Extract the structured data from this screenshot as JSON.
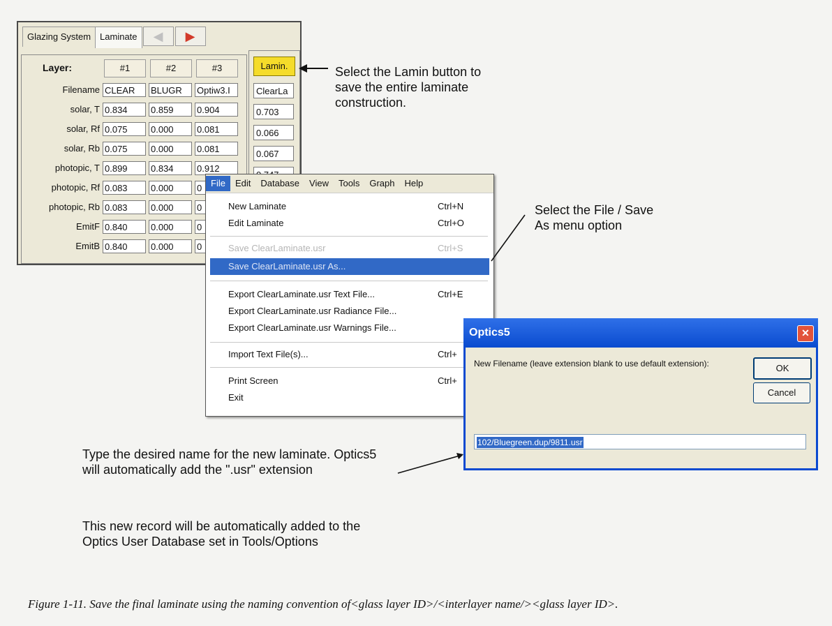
{
  "tabs": {
    "glazing_system": "Glazing System",
    "laminate": "Laminate",
    "prev_arrow": "◀",
    "next_arrow": "▶"
  },
  "grid": {
    "layer_header": "Layer:",
    "columns": [
      "#1",
      "#2",
      "#3"
    ],
    "row_labels": [
      "Filename",
      "solar, T",
      "solar, Rf",
      "solar, Rb",
      "photopic, T",
      "photopic, Rf",
      "photopic, Rb",
      "EmitF",
      "EmitB"
    ],
    "rows": [
      [
        "CLEAR",
        "BLUGR",
        "Optiw3.I"
      ],
      [
        "0.834",
        "0.859",
        "0.904"
      ],
      [
        "0.075",
        "0.000",
        "0.081"
      ],
      [
        "0.075",
        "0.000",
        "0.081"
      ],
      [
        "0.899",
        "0.834",
        "0.912"
      ],
      [
        "0.083",
        "0.000",
        "0"
      ],
      [
        "0.083",
        "0.000",
        "0"
      ],
      [
        "0.840",
        "0.000",
        "0"
      ],
      [
        "0.840",
        "0.000",
        "0"
      ]
    ],
    "lamin_button": "Lamin.",
    "lamin_values": [
      "ClearLa",
      "0.703",
      "0.066",
      "0.067",
      "0.747"
    ]
  },
  "menu": {
    "bar": [
      "File",
      "Edit",
      "Database",
      "View",
      "Tools",
      "Graph",
      "Help"
    ],
    "items": [
      {
        "label": "New Laminate",
        "shortcut": "Ctrl+N"
      },
      {
        "label": "Edit Laminate",
        "shortcut": "Ctrl+O"
      },
      {
        "label": "Save ClearLaminate.usr",
        "shortcut": "Ctrl+S"
      },
      {
        "label": "Save ClearLaminate.usr As...",
        "shortcut": ""
      },
      {
        "label": "Export ClearLaminate.usr Text File...",
        "shortcut": "Ctrl+E"
      },
      {
        "label": "Export ClearLaminate.usr Radiance File...",
        "shortcut": ""
      },
      {
        "label": "Export ClearLaminate.usr Warnings File...",
        "shortcut": ""
      },
      {
        "label": "Import Text File(s)...",
        "shortcut": "Ctrl+"
      },
      {
        "label": "Print Screen",
        "shortcut": "Ctrl+"
      },
      {
        "label": "Exit",
        "shortcut": ""
      }
    ]
  },
  "dialog": {
    "title": "Optics5",
    "close": "✕",
    "prompt": "New Filename (leave extension blank to use default extension):",
    "ok": "OK",
    "cancel": "Cancel",
    "input_value": "102/Bluegreen.dup/9811.usr"
  },
  "notes": {
    "lamin": "Select the Lamin button to save the entire laminate construction.",
    "file": "Select the File / Save As menu option",
    "type_name": "Type the desired name for the new laminate. Optics5 will automatically add the \".usr\" extension",
    "record": "This new record will be automatically added to the Optics User Database set in Tools/Options"
  },
  "caption": "Figure 1-11. Save the final laminate using the naming convention of<glass layer ID>/<interlayer name/><glass layer ID>.",
  "colors": {
    "lamin_button": "#f5dc2a",
    "selection": "#3169c6",
    "title_bar": "#0a4bcf",
    "arrow": "#d23a2a"
  }
}
